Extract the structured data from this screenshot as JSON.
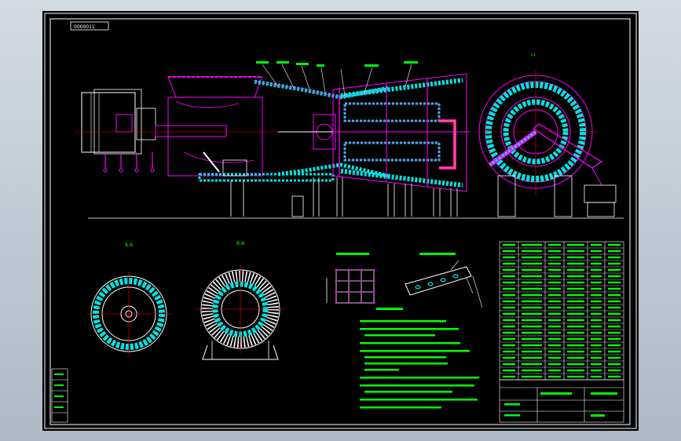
{
  "drawing": {
    "title_tag": "0000011",
    "section_a_label": "A-A",
    "section_b_label": "B-B",
    "detail_label": "I-I",
    "detail_1_title": "",
    "detail_2_title": "",
    "notes_title": "",
    "title_block_name": "",
    "title_block_sub": "",
    "title_block_scale": ""
  },
  "colors": {
    "background": "#000000",
    "frame": "#ffffff",
    "refractory": "#00e5e5",
    "steel": "#ff00ff",
    "table": "#00ff00",
    "ground": "#ffffff"
  },
  "icons": {
    "motor": "motor-icon",
    "rotary-dryer": "dryer-drum-icon"
  }
}
